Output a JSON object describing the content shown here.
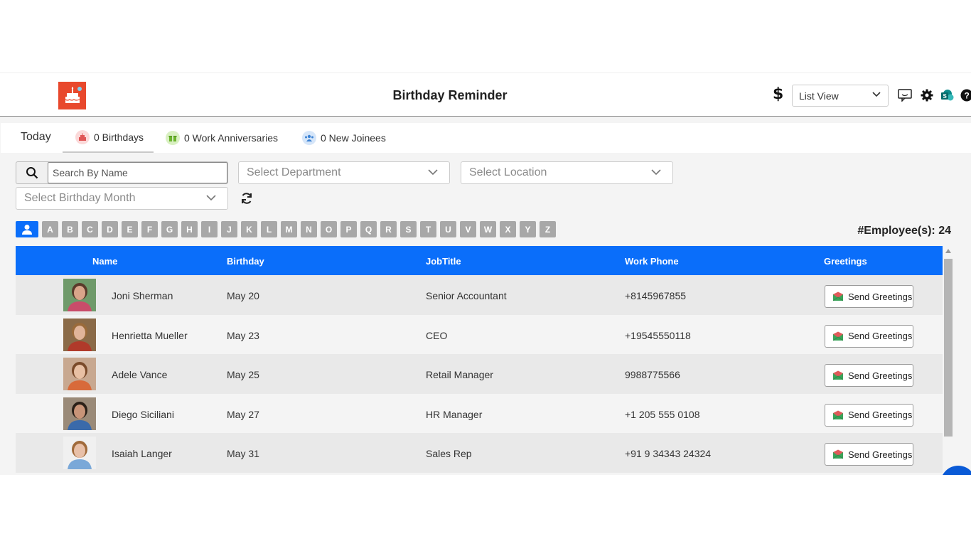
{
  "header": {
    "title": "Birthday Reminder",
    "currency_symbol": "$",
    "view_select": "List View"
  },
  "tabs": {
    "today": "Today",
    "birthdays": "0 Birthdays",
    "anniversaries": "0 Work Anniversaries",
    "joinees": "0 New Joinees"
  },
  "filters": {
    "search_placeholder": "Search By Name",
    "department": "Select Department",
    "location": "Select Location",
    "month": "Select Birthday Month"
  },
  "alphabet": [
    "A",
    "B",
    "C",
    "D",
    "E",
    "F",
    "G",
    "H",
    "I",
    "J",
    "K",
    "L",
    "M",
    "N",
    "O",
    "P",
    "Q",
    "R",
    "S",
    "T",
    "U",
    "V",
    "W",
    "X",
    "Y",
    "Z"
  ],
  "employee_count": "#Employee(s): 24",
  "table": {
    "headers": {
      "name": "Name",
      "birthday": "Birthday",
      "jobtitle": "JobTitle",
      "phone": "Work Phone",
      "greetings": "Greetings"
    },
    "greet_label": "Send Greetings",
    "rows": [
      {
        "name": "Joni Sherman",
        "birthday": "May 20",
        "jobtitle": "Senior Accountant",
        "phone": "+8145967855"
      },
      {
        "name": "Henrietta Mueller",
        "birthday": "May 23",
        "jobtitle": "CEO",
        "phone": "+19545550118"
      },
      {
        "name": "Adele Vance",
        "birthday": "May 25",
        "jobtitle": "Retail Manager",
        "phone": "9988775566"
      },
      {
        "name": "Diego Siciliani",
        "birthday": "May 27",
        "jobtitle": "HR Manager",
        "phone": "+1 205 555 0108"
      },
      {
        "name": "Isaiah Langer",
        "birthday": "May 31",
        "jobtitle": "Sales Rep",
        "phone": "+91 9 34343 24324"
      }
    ]
  },
  "colors": {
    "accent": "#0a6efa",
    "logo": "#e8482c",
    "letter_bg": "#a8a8a8"
  }
}
